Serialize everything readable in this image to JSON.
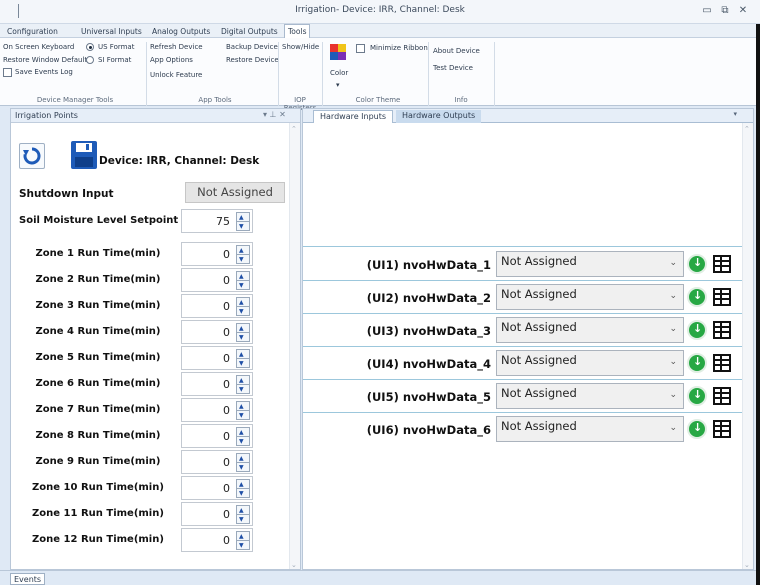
{
  "window": {
    "title": "Irrigation- Device: IRR,  Channel: Desk",
    "minimize": "▭",
    "restore": "⧉",
    "close": "✕"
  },
  "ribbon": {
    "tabs": [
      "Configuration",
      "Universal Inputs",
      "Analog Outputs",
      "Digital Outputs",
      "Tools"
    ],
    "active_tab": "Tools",
    "device_manager_tools": {
      "group": "Device Manager Tools",
      "on_screen_keyboard": "On Screen Keyboard",
      "restore_window_defaults": "Restore Window Defaults",
      "save_events_log": "Save Events Log",
      "us_format": "US Format",
      "si_format": "SI Format"
    },
    "app_tools": {
      "group": "App Tools",
      "refresh_device": "Refresh Device",
      "app_options": "App Options",
      "unlock_feature": "Unlock Feature",
      "backup_device": "Backup Device",
      "restore_device": "Restore Device"
    },
    "iop_registers": {
      "group": "IOP Registers",
      "show_hide": "Show/Hide"
    },
    "color_theme": {
      "group": "Color Theme",
      "minimize_ribbon": "Minimize Ribbon",
      "color": "Color"
    },
    "info": {
      "group": "Info",
      "about_device": "About Device",
      "test_device": "Test Device"
    }
  },
  "left_panel": {
    "title": "Irrigation Points",
    "pin": "▾  ⊥  ✕",
    "device_label": "Device: IRR, Channel: Desk",
    "shutdown_label": "Shutdown Input",
    "shutdown_value": "Not Assigned",
    "setpoint_label": "Soil Moisture Level Setpoint",
    "setpoint_value": "75",
    "zones": [
      {
        "label": "Zone 1 Run Time(min)",
        "value": "0"
      },
      {
        "label": "Zone 2 Run Time(min)",
        "value": "0"
      },
      {
        "label": "Zone 3 Run Time(min)",
        "value": "0"
      },
      {
        "label": "Zone 4 Run Time(min)",
        "value": "0"
      },
      {
        "label": "Zone 5 Run Time(min)",
        "value": "0"
      },
      {
        "label": "Zone 6 Run Time(min)",
        "value": "0"
      },
      {
        "label": "Zone 7 Run Time(min)",
        "value": "0"
      },
      {
        "label": "Zone 8 Run Time(min)",
        "value": "0"
      },
      {
        "label": "Zone 9 Run Time(min)",
        "value": "0"
      },
      {
        "label": "Zone 10 Run Time(min)",
        "value": "0"
      },
      {
        "label": "Zone 11 Run Time(min)",
        "value": "0"
      },
      {
        "label": "Zone 12 Run Time(min)",
        "value": "0"
      }
    ]
  },
  "right_panel": {
    "tabs": [
      "Hardware Inputs",
      "Hardware Outputs"
    ],
    "active_tab": "Hardware Inputs",
    "menu": "▾",
    "inputs": [
      {
        "name": "(UI1) nvoHwData_1",
        "value": "Not Assigned"
      },
      {
        "name": "(UI2) nvoHwData_2",
        "value": "Not Assigned"
      },
      {
        "name": "(UI3) nvoHwData_3",
        "value": "Not Assigned"
      },
      {
        "name": "(UI4) nvoHwData_4",
        "value": "Not Assigned"
      },
      {
        "name": "(UI5) nvoHwData_5",
        "value": "Not Assigned"
      },
      {
        "name": "(UI6) nvoHwData_6",
        "value": "Not Assigned"
      }
    ]
  },
  "bottom": {
    "events_tab": "Events"
  },
  "colors": {
    "accent": "#1e5bb8",
    "download_green": "#27a844",
    "panel_header": "#e6eef8",
    "separator_line": "#9cc7dc"
  }
}
